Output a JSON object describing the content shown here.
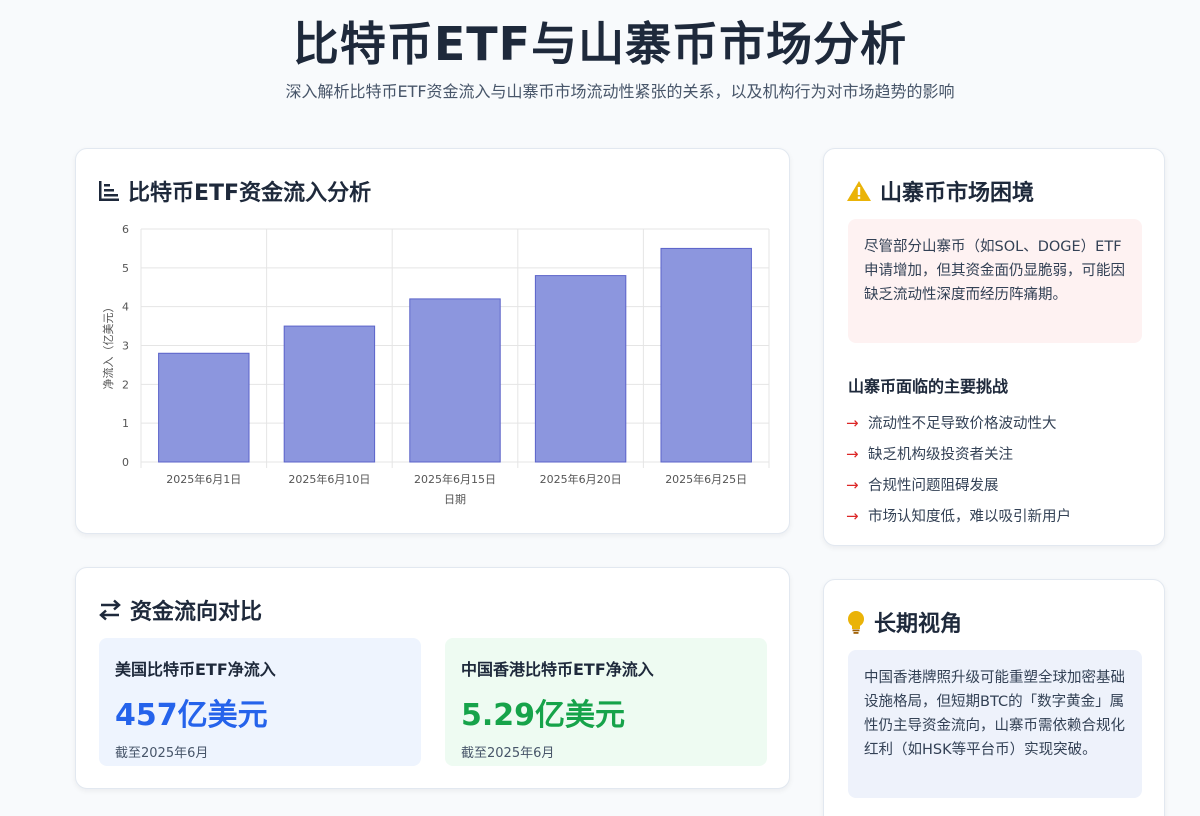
{
  "header": {
    "title": "比特币ETF与山寨币市场分析",
    "subtitle": "深入解析比特币ETF资金流入与山寨币市场流动性紧张的关系，以及机构行为对市场趋势的影响"
  },
  "chart_card": {
    "title": "比特币ETF资金流入分析",
    "icon": "bar-chart-icon"
  },
  "chart_data": {
    "type": "bar",
    "categories": [
      "2025年6月1日",
      "2025年6月10日",
      "2025年6月15日",
      "2025年6月20日",
      "2025年6月25日"
    ],
    "values": [
      2.8,
      3.5,
      4.2,
      4.8,
      5.5
    ],
    "xlabel": "日期",
    "ylabel": "净流入（亿美元）",
    "ylim": [
      0,
      6
    ],
    "yticks": [
      0,
      1,
      2,
      3,
      4,
      5,
      6
    ],
    "grid": true,
    "bar_color": "#8c96de",
    "bar_border_color": "#5b63c9"
  },
  "flow_card": {
    "title": "资金流向对比",
    "icon": "exchange-arrows-icon",
    "us": {
      "label": "美国比特币ETF净流入",
      "value": "457亿美元",
      "note": "截至2025年6月",
      "color": "#2563eb",
      "bg": "#eef4fe"
    },
    "hk": {
      "label": "中国香港比特币ETF净流入",
      "value": "5.29亿美元",
      "note": "截至2025年6月",
      "color": "#16a34a",
      "bg": "#eefbf2"
    }
  },
  "alt_card": {
    "title": "山寨币市场困境",
    "icon": "warning-triangle-icon",
    "icon_color": "#eab308",
    "warning_text": "尽管部分山寨币（如SOL、DOGE）ETF申请增加，但其资金面仍显脆弱，可能因缺乏流动性深度而经历阵痛期。",
    "challenges_heading": "山寨币面临的主要挑战",
    "challenges": [
      "流动性不足导致价格波动性大",
      "缺乏机构级投资者关注",
      "合规性问题阻碍发展",
      "市场认知度低，难以吸引新用户"
    ],
    "arrow_icon": "arrow-right-icon"
  },
  "long_card": {
    "title": "长期视角",
    "icon": "lightbulb-icon",
    "icon_color": "#eab308",
    "text": "中国香港牌照升级可能重塑全球加密基础设施格局，但短期BTC的「数字黄金」属性仍主导资金流向，山寨币需依赖合规化红利（如HSK等平台币）实现突破。"
  }
}
